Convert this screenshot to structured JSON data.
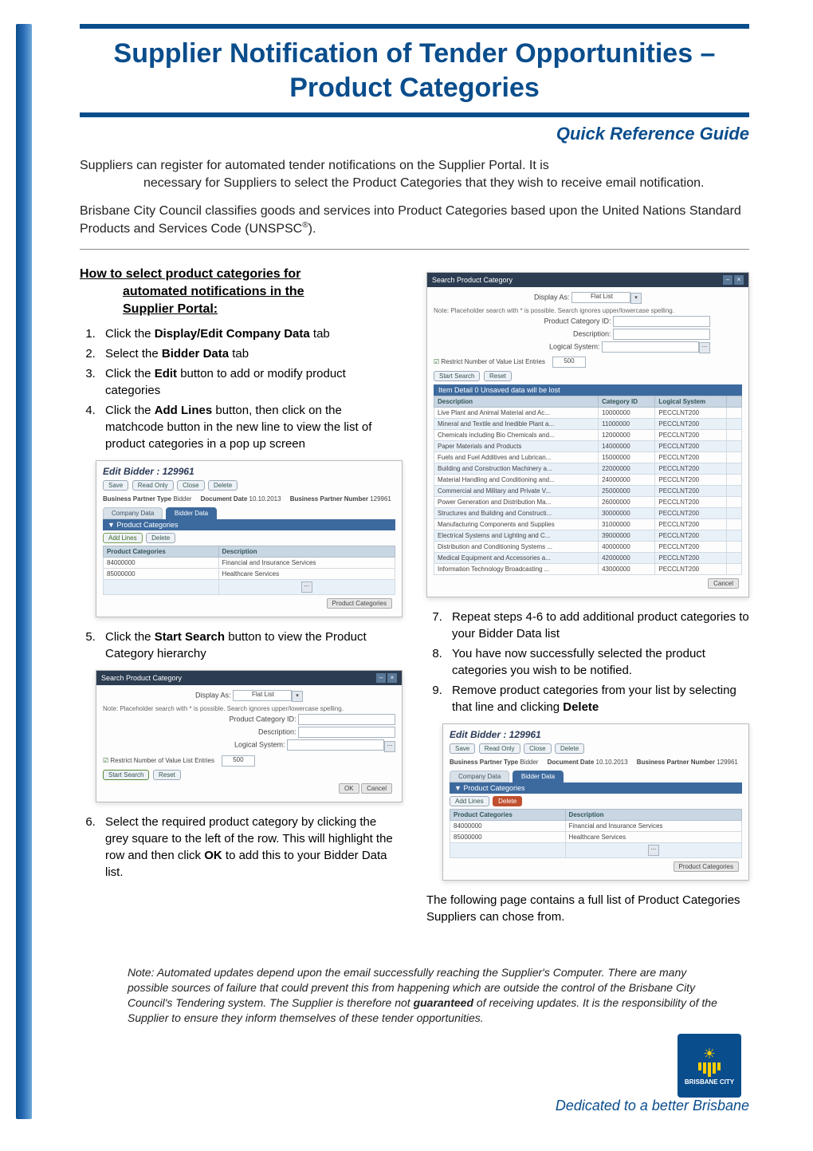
{
  "header": {
    "title": "Supplier Notification of Tender Opportunities – Product Categories",
    "subtitle": "Quick Reference Guide"
  },
  "intro": {
    "p1_lead": "Suppliers can register for automated tender notifications on the Supplier Portal. It is",
    "p1_cont": "necessary for Suppliers to select the Product Categories that they wish to receive email notification.",
    "p2": "Brisbane City Council classifies goods and services into Product Categories based upon the United Nations Standard Products and Services Code (UNSPSC",
    "p2_sup": "®",
    "p2_end": ")."
  },
  "howto": {
    "heading_l1": "How to select product categories for",
    "heading_l2": "automated notifications in the",
    "heading_l3": "Supplier Portal:",
    "steps_left": [
      "Click the <b>Display/Edit Company Data</b> tab",
      "Select the <b>Bidder Data</b> tab",
      "Click the <b>Edit</b> button to add or modify product categories",
      "Click the <b>Add Lines</b> button, then click on the matchcode button in the new line to view the list of product categories in a pop up screen"
    ],
    "step5": "Click the <b>Start Search</b> button to view the Product Category hierarchy",
    "step6": "Select the required product category by clicking the grey square to the left of the row. This will highlight the row and then click <b>OK</b> to add this to your Bidder Data list.",
    "steps_right": [
      "Repeat steps 4-6 to add additional product categories to your Bidder Data list",
      "You have now successfully selected the product categories you wish to be notified.",
      "Remove product categories from your list by selecting that line and clicking <b>Delete</b>"
    ],
    "following": "The following page contains a full list of Product Categories Suppliers can chose from."
  },
  "shot_edit": {
    "title": "Edit Bidder : 129961",
    "btn_save": "Save",
    "btn_readonly": "Read Only",
    "btn_close": "Close",
    "btn_delete": "Delete",
    "bp_type_label": "Business Partner Type",
    "bp_type_val": "Bidder",
    "doc_date_label": "Document Date",
    "doc_date_val": "10.10.2013",
    "bp_num_label": "Business Partner Number",
    "bp_num_val": "129961",
    "tab_company": "Company Data",
    "tab_bidder": "Bidder Data",
    "section": "Product Categories",
    "addlines": "Add Lines",
    "delete": "Delete",
    "col1": "Product Categories",
    "col2": "Description",
    "rows": [
      {
        "code": "84000000",
        "desc": "Financial and Insurance Services"
      },
      {
        "code": "85000000",
        "desc": "Healthcare Services"
      }
    ],
    "pc_btn": "Product Categories"
  },
  "shot_search_small": {
    "title": "Search Product Category",
    "display_as": "Display As:",
    "display_val": "Flat List",
    "note": "Note: Placeholder search with * is possible. Search ignores upper/lowercase spelling.",
    "lbl_pcid": "Product Category ID:",
    "lbl_desc": "Description:",
    "lbl_logical": "Logical System:",
    "restrict": "Restrict Number of Value List Entries",
    "restrict_val": "500",
    "start": "Start Search",
    "reset": "Reset",
    "ok": "OK",
    "cancel": "Cancel"
  },
  "shot_search_big": {
    "title": "Search Product Category",
    "display_as": "Display As:",
    "display_val": "Flat List",
    "note": "Note: Placeholder search with * is possible. Search ignores upper/lowercase spelling.",
    "lbl_pcid": "Product Category ID:",
    "lbl_desc": "Description:",
    "lbl_logical": "Logical System:",
    "restrict": "Restrict Number of Value List Entries",
    "restrict_val": "500",
    "start": "Start Search",
    "reset": "Reset",
    "detail": "Item Detail 0 Unsaved data will be lost",
    "col_desc": "Description",
    "col_cat": "Category ID",
    "col_log": "Logical System",
    "rows": [
      {
        "d": "Live Plant and Animal Material and Ac...",
        "c": "10000000",
        "l": "PECCLNT200"
      },
      {
        "d": "Mineral and Textile and Inedible Plant a...",
        "c": "11000000",
        "l": "PECCLNT200"
      },
      {
        "d": "Chemicals including Bio Chemicals and...",
        "c": "12000000",
        "l": "PECCLNT200"
      },
      {
        "d": "Paper Materials and Products",
        "c": "14000000",
        "l": "PECCLNT200"
      },
      {
        "d": "Fuels and Fuel Additives and Lubrican...",
        "c": "15000000",
        "l": "PECCLNT200"
      },
      {
        "d": "Building and Construction Machinery a...",
        "c": "22000000",
        "l": "PECCLNT200"
      },
      {
        "d": "Material Handling and Conditioning and...",
        "c": "24000000",
        "l": "PECCLNT200"
      },
      {
        "d": "Commercial and Military and Private V...",
        "c": "25000000",
        "l": "PECCLNT200"
      },
      {
        "d": "Power Generation and Distribution Ma...",
        "c": "26000000",
        "l": "PECCLNT200"
      },
      {
        "d": "Structures and Building and Constructi...",
        "c": "30000000",
        "l": "PECCLNT200"
      },
      {
        "d": "Manufacturing Components and Supplies",
        "c": "31000000",
        "l": "PECCLNT200"
      },
      {
        "d": "Electrical Systems and Lighting and C...",
        "c": "39000000",
        "l": "PECCLNT200"
      },
      {
        "d": "Distribution and Conditioning Systems ...",
        "c": "40000000",
        "l": "PECCLNT200"
      },
      {
        "d": "Medical Equipment and Accessories a...",
        "c": "42000000",
        "l": "PECCLNT200"
      },
      {
        "d": "Information Technology Broadcasting ...",
        "c": "43000000",
        "l": "PECCLNT200"
      }
    ],
    "cancel": "Cancel"
  },
  "note": "Note: Automated updates depend upon the email successfully reaching the Supplier's Computer. There are many possible sources of failure that could prevent this from happening which are outside the control of the Brisbane City Council's Tendering system. The Supplier is therefore not <b>guaranteed</b> of receiving updates. It is the responsibility of the Supplier to ensure they inform themselves of these tender opportunities.",
  "footer": {
    "logo_text": "BRISBANE CITY",
    "tagline": "Dedicated to a better Brisbane"
  }
}
